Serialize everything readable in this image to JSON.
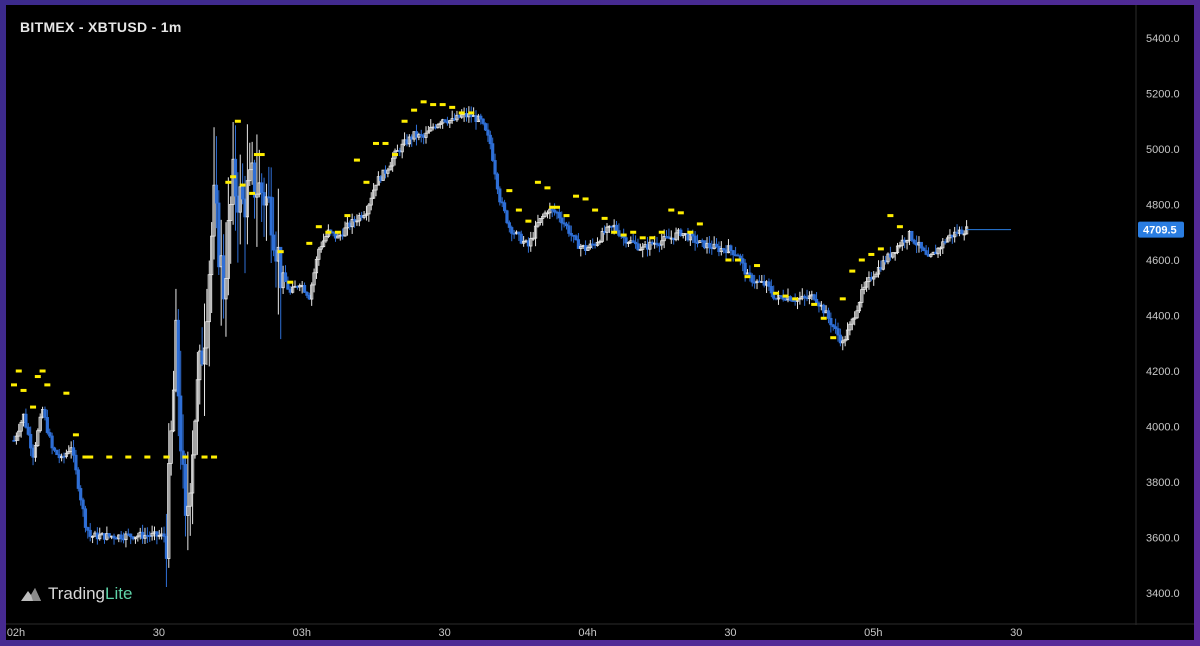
{
  "title": "BITMEX - XBTUSD - 1m",
  "brand": {
    "name_main": "Trading",
    "name_accent": "Lite",
    "logo_icon": "tradinglite-logo-icon"
  },
  "colors": {
    "background": "#000000",
    "up_candle": "#e8e8e8",
    "down_candle": "#2f6fd6",
    "marker": "#ffee00",
    "last_price_tag": "#2a7de1",
    "axis_text": "#c8c8c8",
    "frame": "#4a2e9a"
  },
  "chart_data": {
    "type": "candlestick",
    "symbol": "XBTUSD",
    "exchange": "BITMEX",
    "timeframe": "1m",
    "x_tick_labels": [
      "02h",
      "30",
      "03h",
      "30",
      "04h",
      "30",
      "05h",
      "30"
    ],
    "x_range_minutes": [
      0,
      210
    ],
    "y_tick_labels": [
      "5400.0",
      "5200.0",
      "5000.0",
      "4800.0",
      "4600.0",
      "4400.0",
      "4200.0",
      "4000.0",
      "3800.0",
      "3600.0",
      "3400.0"
    ],
    "y_ticks": [
      5400,
      5200,
      5000,
      4800,
      4600,
      4400,
      4200,
      4000,
      3800,
      3600,
      3400
    ],
    "ylim": [
      3300,
      5520
    ],
    "last_price": 4709.5,
    "last_price_label": "4709.5",
    "price_path": [
      [
        0,
        3950
      ],
      [
        2,
        4040
      ],
      [
        4,
        3900
      ],
      [
        6,
        4060
      ],
      [
        8,
        3920
      ],
      [
        10,
        3880
      ],
      [
        12,
        3930
      ],
      [
        15,
        3650
      ],
      [
        16,
        3605
      ],
      [
        20,
        3605
      ],
      [
        28,
        3608
      ],
      [
        32,
        3605
      ],
      [
        34,
        4300
      ],
      [
        36,
        3620
      ],
      [
        38,
        4050
      ],
      [
        40,
        4350
      ],
      [
        42,
        4800
      ],
      [
        44,
        4500
      ],
      [
        46,
        4880
      ],
      [
        48,
        4800
      ],
      [
        50,
        4880
      ],
      [
        52,
        4850
      ],
      [
        54,
        4780
      ],
      [
        56,
        4560
      ],
      [
        58,
        4480
      ],
      [
        60,
        4520
      ],
      [
        62,
        4470
      ],
      [
        64,
        4640
      ],
      [
        66,
        4700
      ],
      [
        68,
        4680
      ],
      [
        70,
        4720
      ],
      [
        72,
        4750
      ],
      [
        74,
        4780
      ],
      [
        76,
        4880
      ],
      [
        78,
        4920
      ],
      [
        80,
        4980
      ],
      [
        82,
        5020
      ],
      [
        84,
        5050
      ],
      [
        86,
        5040
      ],
      [
        88,
        5080
      ],
      [
        90,
        5110
      ],
      [
        92,
        5100
      ],
      [
        94,
        5120
      ],
      [
        96,
        5120
      ],
      [
        98,
        5100
      ],
      [
        100,
        5020
      ],
      [
        102,
        4820
      ],
      [
        104,
        4720
      ],
      [
        106,
        4680
      ],
      [
        108,
        4650
      ],
      [
        110,
        4730
      ],
      [
        112,
        4780
      ],
      [
        114,
        4770
      ],
      [
        116,
        4720
      ],
      [
        118,
        4660
      ],
      [
        120,
        4640
      ],
      [
        122,
        4660
      ],
      [
        124,
        4700
      ],
      [
        126,
        4720
      ],
      [
        128,
        4680
      ],
      [
        130,
        4660
      ],
      [
        132,
        4640
      ],
      [
        134,
        4660
      ],
      [
        136,
        4670
      ],
      [
        138,
        4680
      ],
      [
        140,
        4700
      ],
      [
        142,
        4680
      ],
      [
        144,
        4660
      ],
      [
        146,
        4650
      ],
      [
        148,
        4640
      ],
      [
        150,
        4640
      ],
      [
        152,
        4620
      ],
      [
        154,
        4540
      ],
      [
        156,
        4520
      ],
      [
        158,
        4510
      ],
      [
        160,
        4460
      ],
      [
        162,
        4470
      ],
      [
        164,
        4460
      ],
      [
        166,
        4460
      ],
      [
        168,
        4470
      ],
      [
        170,
        4420
      ],
      [
        172,
        4360
      ],
      [
        174,
        4300
      ],
      [
        176,
        4380
      ],
      [
        178,
        4480
      ],
      [
        180,
        4540
      ],
      [
        182,
        4580
      ],
      [
        184,
        4620
      ],
      [
        186,
        4660
      ],
      [
        188,
        4690
      ],
      [
        190,
        4650
      ],
      [
        192,
        4600
      ],
      [
        194,
        4640
      ],
      [
        196,
        4680
      ],
      [
        198,
        4700
      ],
      [
        200,
        4709.5
      ]
    ],
    "liquidation_markers": [
      [
        0,
        4150
      ],
      [
        1,
        4200
      ],
      [
        2,
        4130
      ],
      [
        4,
        4070
      ],
      [
        5,
        4180
      ],
      [
        6,
        4200
      ],
      [
        7,
        4150
      ],
      [
        11,
        4120
      ],
      [
        13,
        3970
      ],
      [
        15,
        3890
      ],
      [
        16,
        3890
      ],
      [
        20,
        3890
      ],
      [
        24,
        3890
      ],
      [
        28,
        3890
      ],
      [
        32,
        3890
      ],
      [
        36,
        3890
      ],
      [
        40,
        3890
      ],
      [
        42,
        3890
      ],
      [
        45,
        4880
      ],
      [
        46,
        4900
      ],
      [
        47,
        5100
      ],
      [
        48,
        4870
      ],
      [
        50,
        4840
      ],
      [
        51,
        4980
      ],
      [
        52,
        4980
      ],
      [
        56,
        4630
      ],
      [
        58,
        4520
      ],
      [
        62,
        4660
      ],
      [
        64,
        4720
      ],
      [
        66,
        4700
      ],
      [
        68,
        4700
      ],
      [
        70,
        4760
      ],
      [
        72,
        4960
      ],
      [
        74,
        4880
      ],
      [
        76,
        5020
      ],
      [
        78,
        5020
      ],
      [
        80,
        4980
      ],
      [
        82,
        5100
      ],
      [
        84,
        5140
      ],
      [
        86,
        5170
      ],
      [
        88,
        5160
      ],
      [
        90,
        5160
      ],
      [
        92,
        5150
      ],
      [
        94,
        5130
      ],
      [
        96,
        5130
      ],
      [
        104,
        4850
      ],
      [
        106,
        4780
      ],
      [
        108,
        4740
      ],
      [
        110,
        4880
      ],
      [
        112,
        4860
      ],
      [
        113,
        4790
      ],
      [
        114,
        4790
      ],
      [
        116,
        4760
      ],
      [
        118,
        4830
      ],
      [
        120,
        4820
      ],
      [
        122,
        4780
      ],
      [
        124,
        4750
      ],
      [
        126,
        4700
      ],
      [
        128,
        4690
      ],
      [
        130,
        4700
      ],
      [
        132,
        4680
      ],
      [
        134,
        4680
      ],
      [
        136,
        4700
      ],
      [
        138,
        4780
      ],
      [
        140,
        4770
      ],
      [
        142,
        4700
      ],
      [
        144,
        4730
      ],
      [
        150,
        4600
      ],
      [
        152,
        4600
      ],
      [
        154,
        4540
      ],
      [
        156,
        4580
      ],
      [
        160,
        4480
      ],
      [
        162,
        4470
      ],
      [
        164,
        4460
      ],
      [
        168,
        4440
      ],
      [
        170,
        4390
      ],
      [
        172,
        4320
      ],
      [
        174,
        4460
      ],
      [
        176,
        4560
      ],
      [
        178,
        4600
      ],
      [
        180,
        4620
      ],
      [
        182,
        4640
      ],
      [
        184,
        4760
      ],
      [
        186,
        4720
      ]
    ]
  }
}
